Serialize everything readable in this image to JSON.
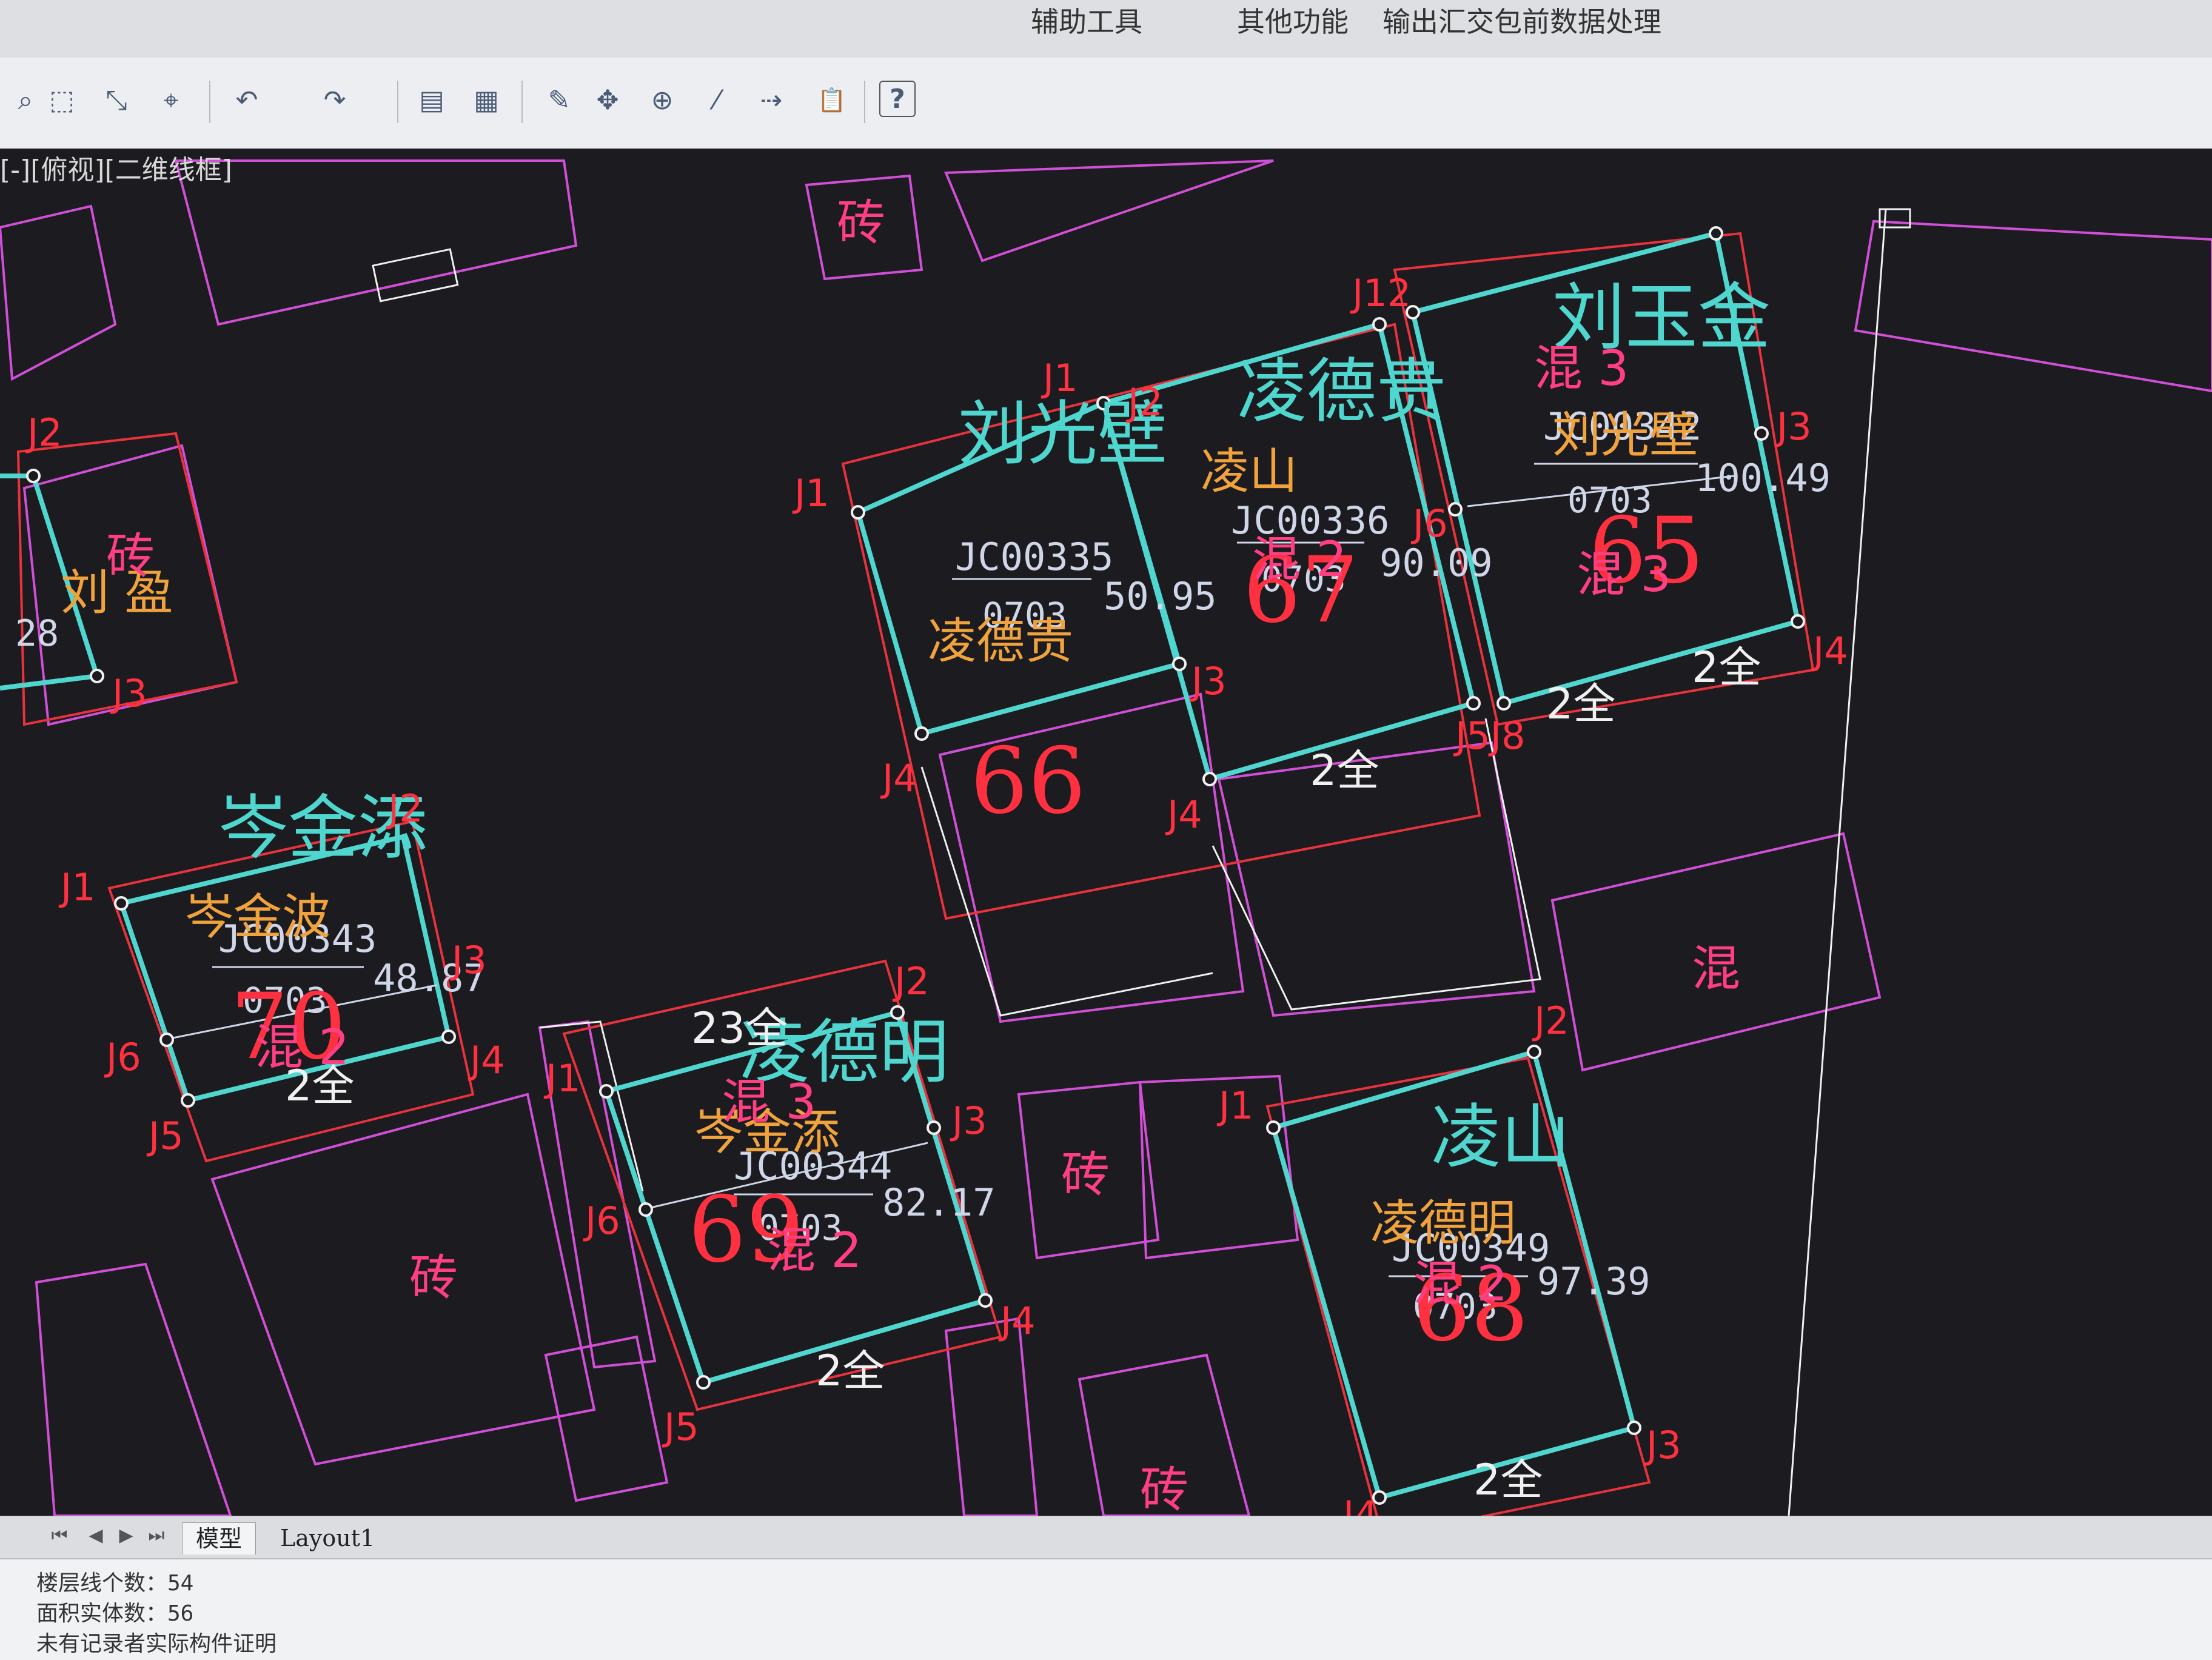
{
  "menu": {
    "items": [
      "辅助工具",
      "其他功能",
      "输出汇交包前数据处理"
    ]
  },
  "toolbar": {
    "tools": [
      {
        "name": "zoom-icon",
        "glyph": "⌕"
      },
      {
        "name": "zoom-window-icon",
        "glyph": "⬚"
      },
      {
        "name": "zoom-extents-icon",
        "glyph": "⤡"
      },
      {
        "name": "zoom-previous-icon",
        "glyph": "⌖"
      },
      {
        "name": "undo-icon",
        "glyph": "↶"
      },
      {
        "name": "redo-icon",
        "glyph": "↷"
      },
      {
        "name": "properties-icon",
        "glyph": "▤"
      },
      {
        "name": "design-center-icon",
        "glyph": "▦"
      },
      {
        "name": "match-properties-icon",
        "glyph": "✎"
      },
      {
        "name": "move-icon",
        "glyph": "✥"
      },
      {
        "name": "copy-icon",
        "glyph": "⊕"
      },
      {
        "name": "trim-icon",
        "glyph": "⁄"
      },
      {
        "name": "extend-icon",
        "glyph": "⇢"
      },
      {
        "name": "paste-icon",
        "glyph": "📋"
      },
      {
        "name": "help-icon",
        "glyph": "?"
      }
    ]
  },
  "viewport": {
    "label": "[-][俯视][二维线框]"
  },
  "colors": {
    "background": "#1b1b20",
    "parcel_outline": "#4fd6cf",
    "building_outline": "#d14fd6",
    "red_outline": "#e8323c",
    "owner_text": "#4fd6cf",
    "code_text": "#cfd6e8",
    "orange_text": "#f0a23c",
    "pink_text": "#ff3f82",
    "number_text": "#ff3040",
    "white": "#f0f0f0"
  },
  "drawing": {
    "owners": [
      "刘玉金",
      "凌德贵",
      "刘光壁",
      "岑金添",
      "凌德明",
      "凌山"
    ],
    "parcel_codes": [
      "JC00335",
      "JC00336",
      "JC00342",
      "JC00343",
      "JC00344",
      "JC00349"
    ],
    "parcel_sub_code": "0703",
    "areas": [
      "50.95",
      "90.09",
      "100.49",
      "48.87",
      "82.17",
      "97.39"
    ],
    "lot_numbers": [
      "66",
      "67",
      "65",
      "70",
      "69",
      "68"
    ],
    "orange_labels": [
      "凌德贵",
      "凌山",
      "刘光壁",
      "岑金波",
      "岑金添",
      "凌德明",
      "刘 盈"
    ],
    "material_labels": [
      "砖",
      "混",
      "混 3",
      "混 2"
    ],
    "wall_labels": [
      "2全",
      "23全"
    ],
    "point_labels": [
      "J1",
      "J2",
      "J3",
      "J4",
      "J5",
      "J6",
      "J12",
      "J5J8"
    ],
    "misc": [
      "28"
    ]
  },
  "tabs": {
    "items": [
      "模型",
      "Layout1"
    ]
  },
  "command": {
    "lines": [
      "楼层线个数：54",
      "面积实体数：56",
      "未有记录者实际构件证明"
    ]
  }
}
